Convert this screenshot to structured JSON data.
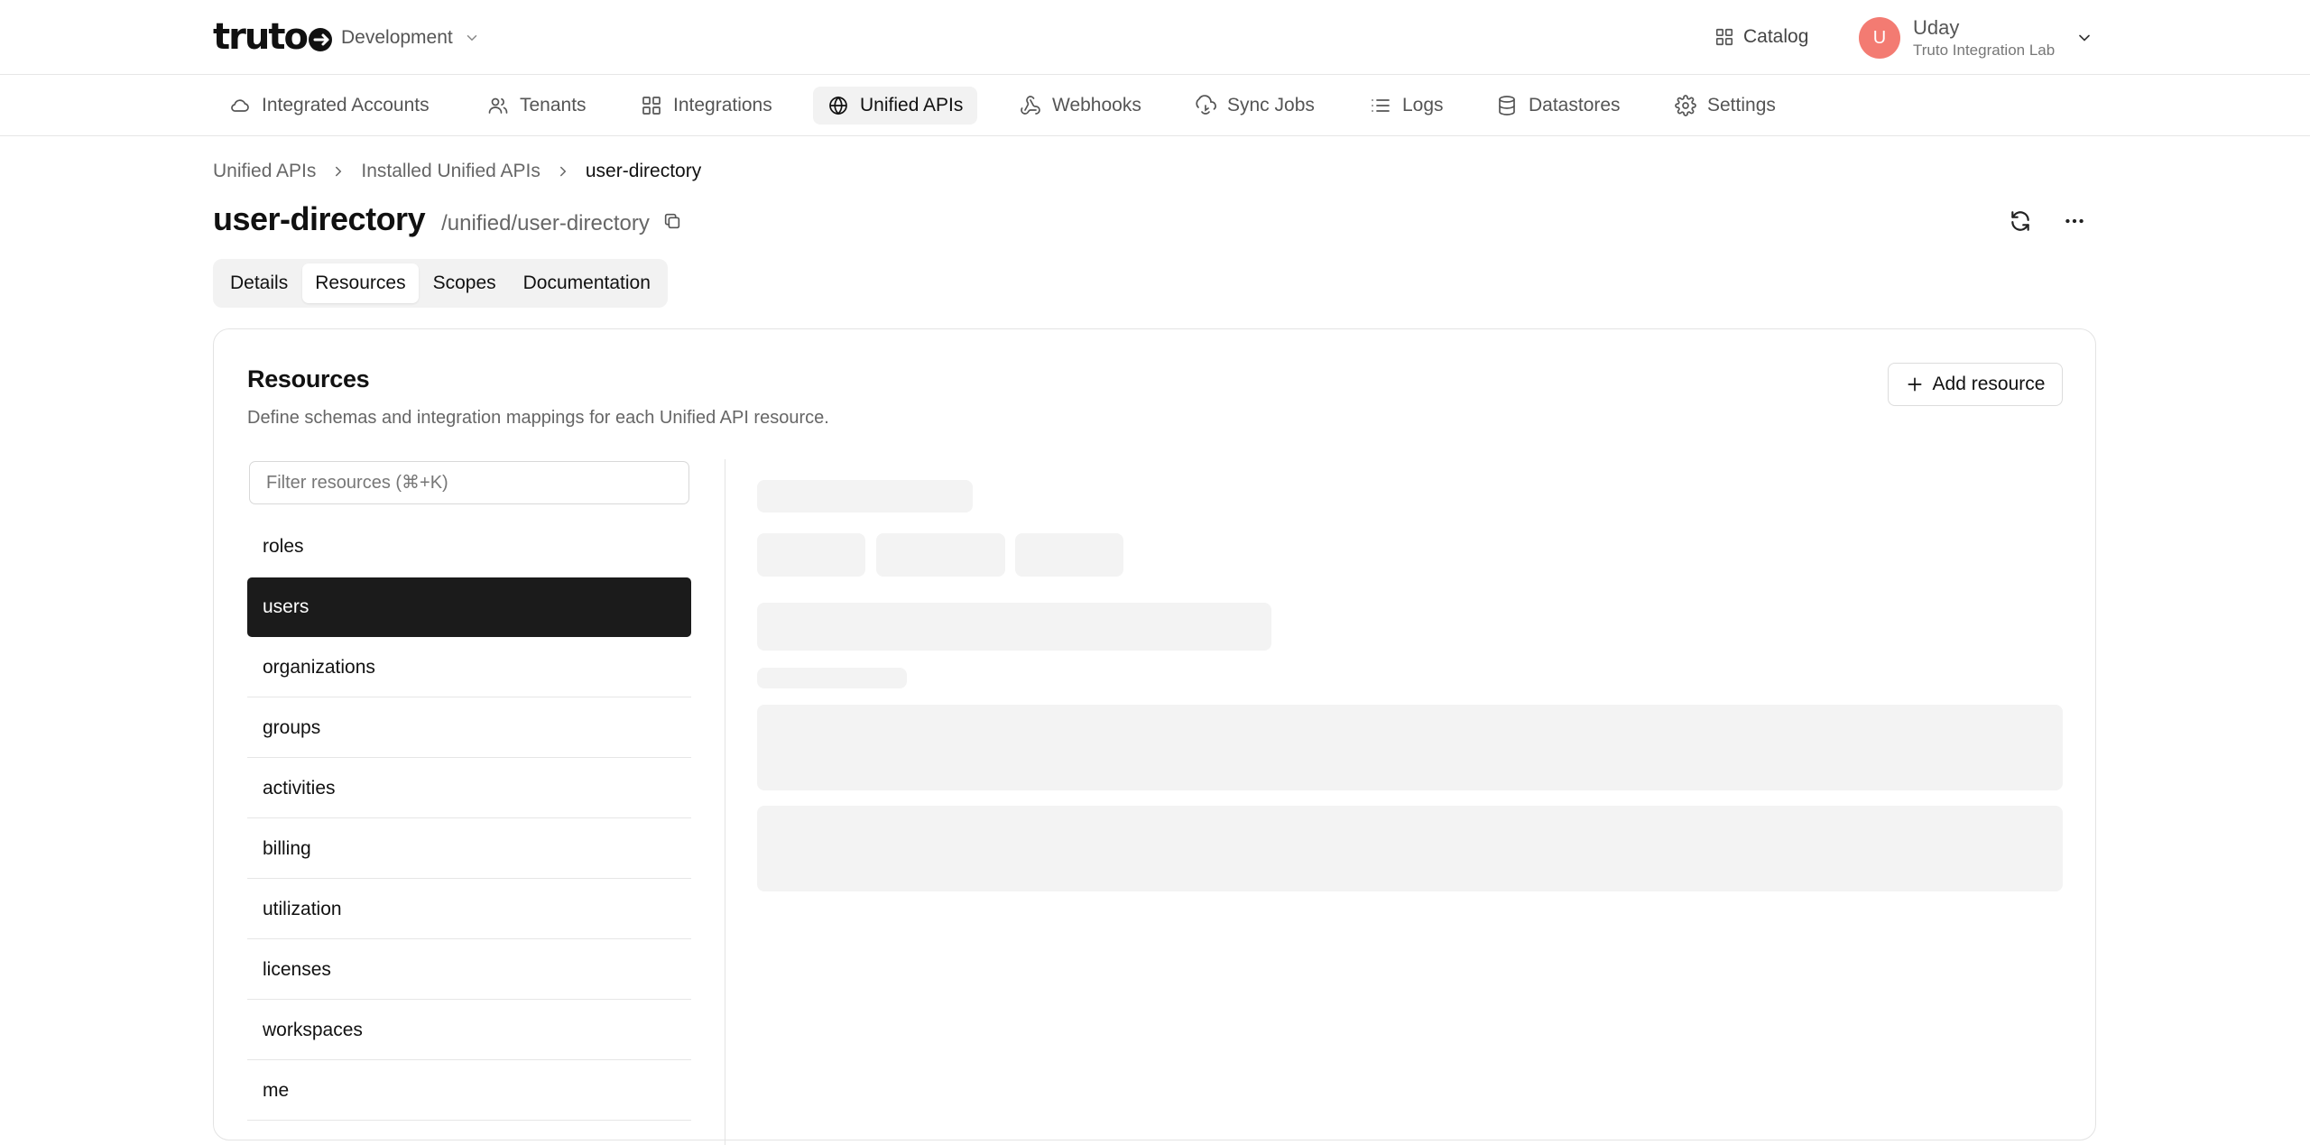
{
  "header": {
    "brand": "truto",
    "environment": "Development",
    "catalog_label": "Catalog",
    "user": {
      "initial": "U",
      "name": "Uday",
      "org": "Truto Integration Lab",
      "avatar_color": "#f37b72"
    }
  },
  "nav": {
    "items": [
      {
        "label": "Integrated Accounts",
        "icon": "cloud-icon"
      },
      {
        "label": "Tenants",
        "icon": "users-icon"
      },
      {
        "label": "Integrations",
        "icon": "grid-icon"
      },
      {
        "label": "Unified APIs",
        "icon": "globe-icon",
        "active": true
      },
      {
        "label": "Webhooks",
        "icon": "webhook-icon"
      },
      {
        "label": "Sync Jobs",
        "icon": "sync-icon"
      },
      {
        "label": "Logs",
        "icon": "list-icon"
      },
      {
        "label": "Datastores",
        "icon": "database-icon"
      },
      {
        "label": "Settings",
        "icon": "gear-icon"
      }
    ]
  },
  "breadcrumb": {
    "items": [
      "Unified APIs",
      "Installed Unified APIs",
      "user-directory"
    ]
  },
  "page": {
    "title": "user-directory",
    "path": "/unified/user-directory"
  },
  "tabs": {
    "items": [
      "Details",
      "Resources",
      "Scopes",
      "Documentation"
    ],
    "active": "Resources"
  },
  "resources": {
    "title": "Resources",
    "description": "Define schemas and integration mappings for each Unified API resource.",
    "add_label": "Add resource",
    "filter_placeholder": "Filter resources (⌘+K)",
    "filter_value": "",
    "items": [
      "roles",
      "users",
      "organizations",
      "groups",
      "activities",
      "billing",
      "utilization",
      "licenses",
      "workspaces",
      "me"
    ],
    "selected": "users"
  }
}
